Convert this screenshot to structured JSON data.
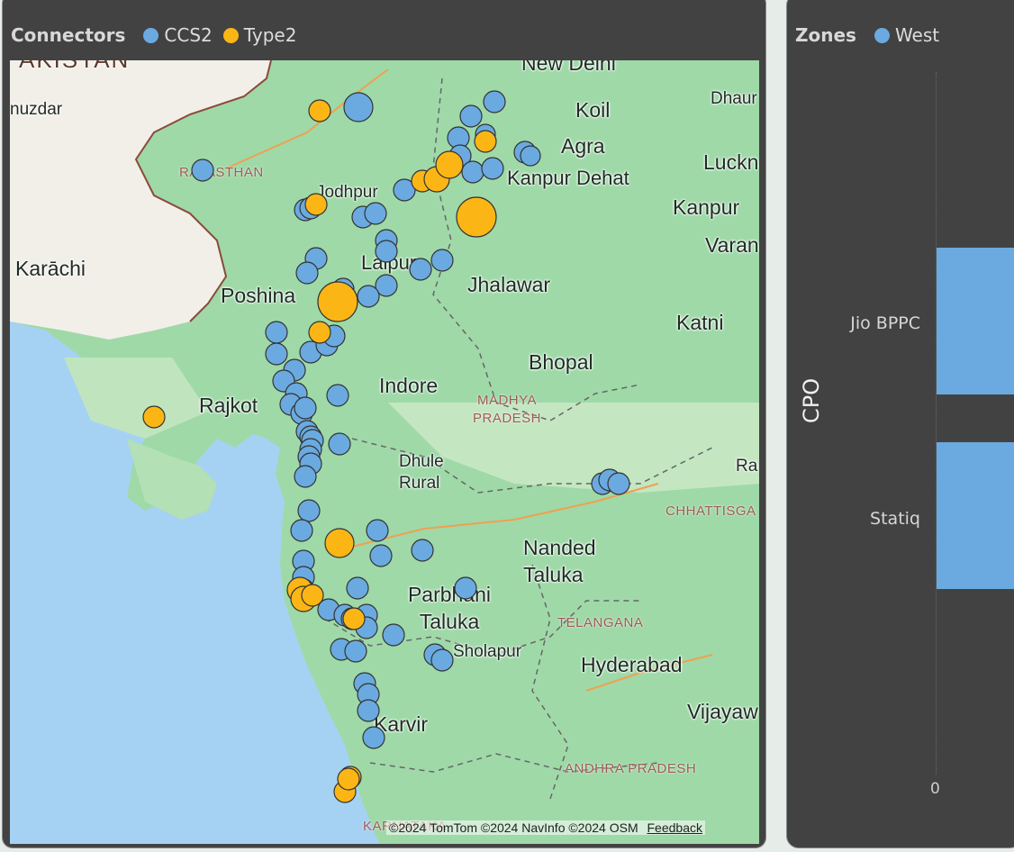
{
  "map_visual": {
    "legend_title": "Connectors",
    "legend_items": [
      {
        "label": "CCS2",
        "color": "#6aaae0"
      },
      {
        "label": "Type2",
        "color": "#fbb616"
      }
    ],
    "place_labels": [
      "New Delhi",
      "Koil",
      "Agra",
      "Luckn",
      "Dhaur",
      "Kanpur Dehat",
      "Kanpur",
      "Varan",
      "Jodhpur",
      "Lalpur",
      "Jhalawar",
      "Poshina",
      "Karāchi",
      "nuzdar",
      "Katni",
      "Bhopal",
      "Indore",
      "Rajkot",
      "Dhule Rural",
      "Ra",
      "Nanded Taluka",
      "Parbhani Taluka",
      "Sholapur",
      "Hyderabad",
      "Vijayaw",
      "Karvir",
      "AKISTAN",
      "RAJASTHAN"
    ],
    "state_labels": [
      "MADHYA PRADESH",
      "CHHATTISGA",
      "TELANGANA",
      "ANDHRA PRADESH",
      "KARNATAKA"
    ],
    "attribution": "©2024 TomTom  ©2024 NavInfo  ©2024 OSM",
    "feedback": "Feedback"
  },
  "bar_visual": {
    "legend_title": "Zones",
    "legend_items": [
      {
        "label": "West",
        "color": "#6aaae0"
      }
    ],
    "axis_title": "CPO",
    "categories": [
      "Jio BPPC",
      "Statiq"
    ],
    "tick_label": "0"
  },
  "chart_data": {
    "type": "bar",
    "orientation": "horizontal",
    "categories": [
      "Jio BPPC",
      "Statiq"
    ],
    "series": [
      {
        "name": "West",
        "values": [
          null,
          null
        ]
      }
    ],
    "ylabel": "CPO",
    "x_tick_labels": [
      "0"
    ]
  }
}
